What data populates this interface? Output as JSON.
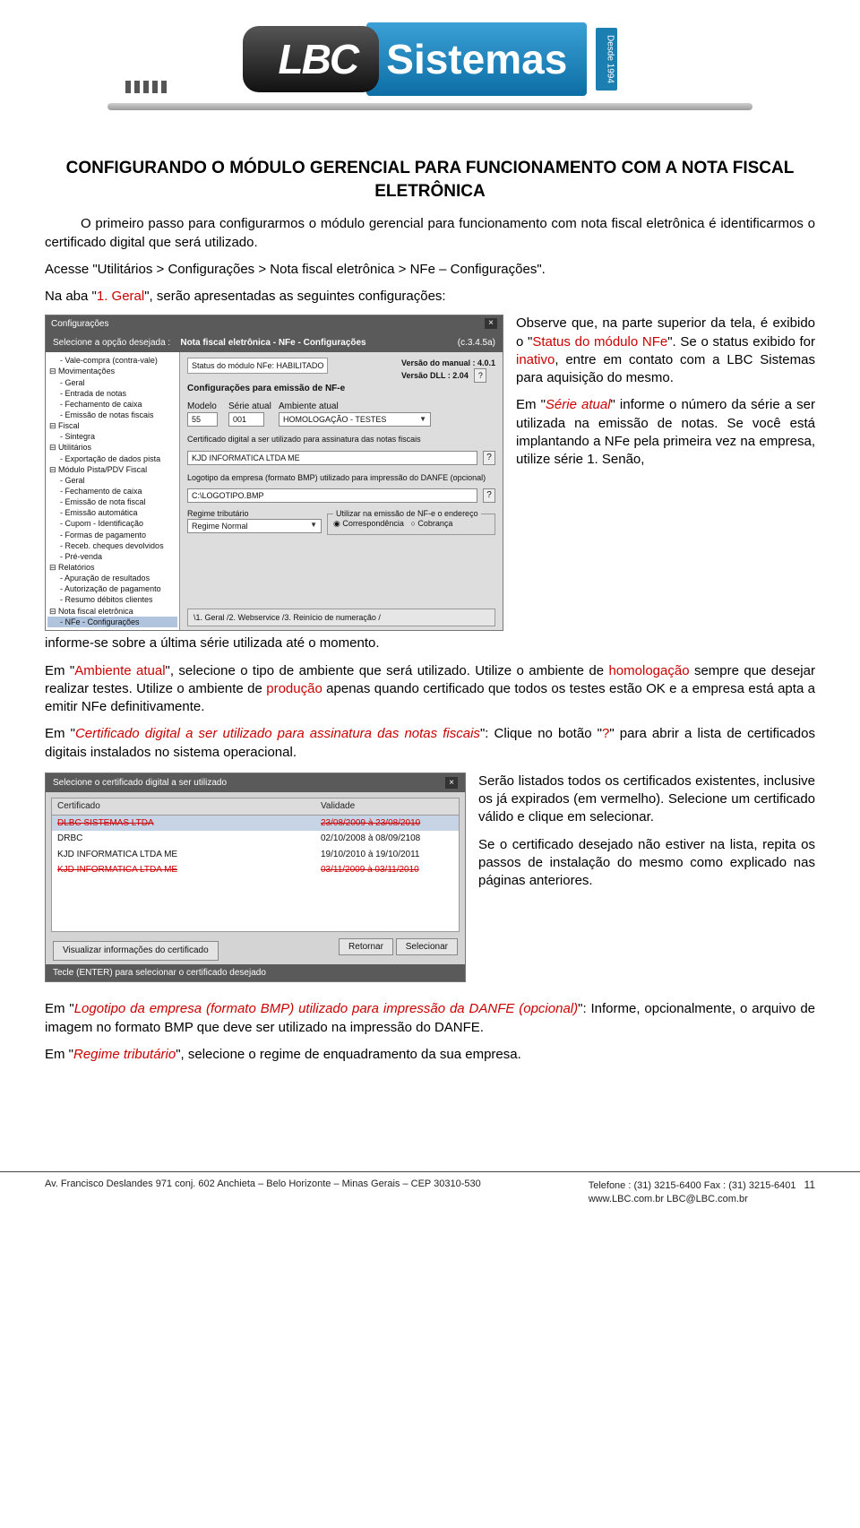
{
  "logo": {
    "lbc": "LBC",
    "sistemas": "Sistemas",
    "since": "Desde 1994"
  },
  "title": "CONFIGURANDO O MÓDULO GERENCIAL PARA FUNCIONAMENTO COM A NOTA FISCAL ELETRÔNICA",
  "p1a": "O primeiro passo para configurarmos o módulo gerencial para funcionamento com nota fiscal eletrônica é identificarmos o certificado digital que será utilizado.",
  "p1b": "Acesse \"Utilitários > Configurações > Nota fiscal eletrônica > NFe – Configurações\".",
  "p2a": "Na aba \"",
  "p2b": "1. Geral",
  "p2c": "\", serão apresentadas as seguintes configurações:",
  "right1a": "Observe que, na parte superior da tela, é exibido o \"",
  "right1b": "Status do módulo NFe",
  "right1c": "\". Se o status exibido for ",
  "right1d": "inativo",
  "right1e": ", entre em contato com a LBC Sistemas para aquisição do mesmo.",
  "right2a": "Em \"",
  "right2b": "Série atual",
  "right2c": "\" informe o número da série a ser utilizada na emissão de notas. Se você está implantando a NFe pela primeira vez na empresa, utilize série 1. Senão,",
  "p3": "informe-se sobre a última série utilizada até o momento.",
  "p4a": "Em \"",
  "p4b": "Ambiente atual",
  "p4c": "\", selecione o tipo de ambiente que será utilizado. Utilize o ambiente de ",
  "p4d": "homologação",
  "p4e": " sempre que desejar realizar testes. Utilize o ambiente de ",
  "p4f": "produção",
  "p4g": " apenas quando certificado que todos os testes estão OK e a empresa está apta a emitir NFe definitivamente.",
  "p5a": "Em \"",
  "p5b": "Certificado digital a ser utilizado para assinatura das notas fiscais",
  "p5c": "\": Clique no botão \"",
  "p5d": "?",
  "p5e": "\" para abrir a lista de certificados digitais instalados no sistema operacional.",
  "right3": "Serão listados todos os certificados existentes, inclusive os já expirados (em vermelho). Selecione um certificado válido e clique em selecionar.",
  "right4": "Se o certificado desejado não estiver na lista, repita os passos de instalação do mesmo como explicado nas páginas anteriores.",
  "p6a": "Em \"",
  "p6b": "Logotipo da empresa (formato BMP) utilizado para impressão da DANFE (opcional)",
  "p6c": "\": Informe, opcionalmente, o arquivo de imagem no formato BMP que deve ser utilizado na impressão do DANFE.",
  "p7a": "Em \"",
  "p7b": "Regime tributário",
  "p7c": "\", selecione o regime de enquadramento da sua empresa.",
  "shot1": {
    "topbar": "Configurações",
    "sel_label": "Selecione a opção desejada :",
    "breadcrumb": "Nota fiscal eletrônica - NFe - Configurações",
    "crumb_ver": "(c.3.4.5a)",
    "tree": [
      {
        "t": "Vale-compra (contra-vale)",
        "l": 2
      },
      {
        "t": "Movimentações",
        "l": 1
      },
      {
        "t": "Geral",
        "l": 2
      },
      {
        "t": "Entrada de notas",
        "l": 2
      },
      {
        "t": "Fechamento de caixa",
        "l": 2
      },
      {
        "t": "Emissão de notas fiscais",
        "l": 2
      },
      {
        "t": "Fiscal",
        "l": 1
      },
      {
        "t": "Sintegra",
        "l": 2
      },
      {
        "t": "Utilitários",
        "l": 1
      },
      {
        "t": "Exportação de dados pista",
        "l": 2
      },
      {
        "t": "Módulo Pista/PDV Fiscal",
        "l": 1
      },
      {
        "t": "Geral",
        "l": 2
      },
      {
        "t": "Fechamento de caixa",
        "l": 2
      },
      {
        "t": "Emissão de nota fiscal",
        "l": 2
      },
      {
        "t": "Emissão automática",
        "l": 2
      },
      {
        "t": "Cupom - Identificação",
        "l": 2
      },
      {
        "t": "Formas de pagamento",
        "l": 2
      },
      {
        "t": "Receb. cheques devolvidos",
        "l": 2
      },
      {
        "t": "Pré-venda",
        "l": 2
      },
      {
        "t": "Relatórios",
        "l": 1
      },
      {
        "t": "Apuração de resultados",
        "l": 2
      },
      {
        "t": "Autorização de pagamento",
        "l": 2
      },
      {
        "t": "Resumo débitos clientes",
        "l": 2
      },
      {
        "t": "Nota fiscal eletrônica",
        "l": 1
      },
      {
        "t": "NFe - Configurações",
        "l": 2,
        "sel": true
      }
    ],
    "status_lbl": "Status do módulo NFe: HABILITADO",
    "ver_manual": "Versão do manual : 4.0.1",
    "ver_dll": "Versão DLL : 2.04",
    "sect": "Configurações para emissão de NF-e",
    "c_modelo": "Modelo",
    "c_serie": "Série atual",
    "c_amb": "Ambiente atual",
    "v_modelo": "55",
    "v_serie": "001",
    "v_amb": "HOMOLOGAÇÃO - TESTES",
    "cert_lbl": "Certificado digital a ser utilizado para assinatura das notas fiscais",
    "cert_val": "KJD INFORMATICA LTDA ME",
    "logo_lbl": "Logotipo da empresa (formato BMP) utilizado para impressão do DANFE (opcional)",
    "logo_val": "C:\\LOGOTIPO.BMP",
    "reg_lbl": "Regime tributário",
    "reg_val": "Regime Normal",
    "end_lbl": "Utilizar na emissão de NF-e o endereço",
    "end_a": "Correspondência",
    "end_b": "Cobrança",
    "tabs": "\\1. Geral /2. Webservice /3. Reinício de numeração /"
  },
  "shot2": {
    "head": "Selecione o certificado digital a ser utilizado",
    "col1": "Certificado",
    "col2": "Validade",
    "rows": [
      {
        "n": "DLBC SISTEMAS LTDA",
        "d": "23/08/2009 à 23/08/2010",
        "sel": true,
        "exp": true
      },
      {
        "n": "DRBC",
        "d": "02/10/2008 à 08/09/2108",
        "sel": false,
        "exp": false
      },
      {
        "n": "KJD INFORMATICA LTDA ME",
        "d": "19/10/2010 à 19/10/2011",
        "sel": false,
        "exp": false
      },
      {
        "n": "KJD INFORMATICA LTDA ME",
        "d": "03/11/2009 à 03/11/2010",
        "sel": false,
        "exp": true
      }
    ],
    "btn_view": "Visualizar informações do certificado",
    "btn_ret": "Retornar",
    "btn_sel": "Selecionar",
    "status": "Tecle (ENTER) para selecionar o certificado desejado"
  },
  "footer": {
    "left": "Av. Francisco Deslandes 971 conj. 602 Anchieta – Belo Horizonte – Minas Gerais – CEP 30310-530",
    "r1": "Telefone : (31) 3215-6400    Fax : (31) 3215-6401",
    "r2": "www.LBC.com.br  LBC@LBC.com.br",
    "page": "11"
  }
}
